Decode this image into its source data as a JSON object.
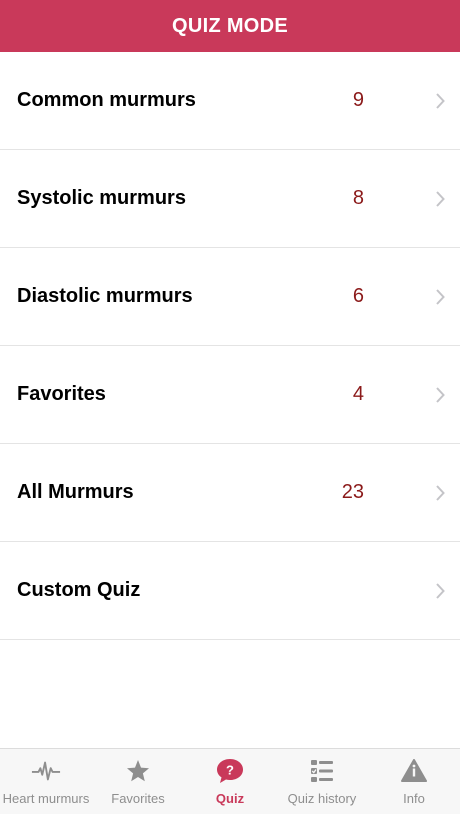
{
  "header": {
    "title": "QUIZ MODE"
  },
  "list": [
    {
      "label": "Common murmurs",
      "count": "9"
    },
    {
      "label": "Systolic murmurs",
      "count": "8"
    },
    {
      "label": "Diastolic murmurs",
      "count": "6"
    },
    {
      "label": "Favorites",
      "count": "4"
    },
    {
      "label": "All Murmurs",
      "count": "23"
    },
    {
      "label": "Custom Quiz",
      "count": ""
    }
  ],
  "tabbar": {
    "tabs": [
      {
        "label": "Heart murmurs",
        "icon": "heartbeat-icon",
        "active": false
      },
      {
        "label": "Favorites",
        "icon": "star-icon",
        "active": false
      },
      {
        "label": "Quiz",
        "icon": "question-bubble-icon",
        "active": true
      },
      {
        "label": "Quiz history",
        "icon": "checklist-icon",
        "active": false
      },
      {
        "label": "Info",
        "icon": "info-icon",
        "active": false
      }
    ]
  },
  "colors": {
    "accent": "#c9395a",
    "count": "#8b1a1a",
    "inactive": "#8e8e8e"
  }
}
